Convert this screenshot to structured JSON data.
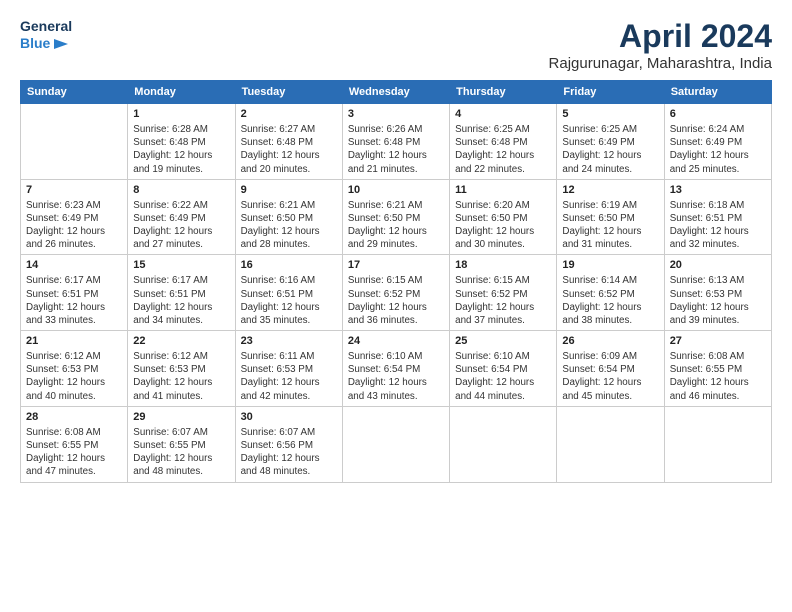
{
  "header": {
    "logo_line1": "General",
    "logo_line2": "Blue",
    "title": "April 2024",
    "subtitle": "Rajgurunagar, Maharashtra, India"
  },
  "columns": [
    "Sunday",
    "Monday",
    "Tuesday",
    "Wednesday",
    "Thursday",
    "Friday",
    "Saturday"
  ],
  "weeks": [
    [
      {
        "day": "",
        "content": ""
      },
      {
        "day": "1",
        "content": "Sunrise: 6:28 AM\nSunset: 6:48 PM\nDaylight: 12 hours\nand 19 minutes."
      },
      {
        "day": "2",
        "content": "Sunrise: 6:27 AM\nSunset: 6:48 PM\nDaylight: 12 hours\nand 20 minutes."
      },
      {
        "day": "3",
        "content": "Sunrise: 6:26 AM\nSunset: 6:48 PM\nDaylight: 12 hours\nand 21 minutes."
      },
      {
        "day": "4",
        "content": "Sunrise: 6:25 AM\nSunset: 6:48 PM\nDaylight: 12 hours\nand 22 minutes."
      },
      {
        "day": "5",
        "content": "Sunrise: 6:25 AM\nSunset: 6:49 PM\nDaylight: 12 hours\nand 24 minutes."
      },
      {
        "day": "6",
        "content": "Sunrise: 6:24 AM\nSunset: 6:49 PM\nDaylight: 12 hours\nand 25 minutes."
      }
    ],
    [
      {
        "day": "7",
        "content": "Sunrise: 6:23 AM\nSunset: 6:49 PM\nDaylight: 12 hours\nand 26 minutes."
      },
      {
        "day": "8",
        "content": "Sunrise: 6:22 AM\nSunset: 6:49 PM\nDaylight: 12 hours\nand 27 minutes."
      },
      {
        "day": "9",
        "content": "Sunrise: 6:21 AM\nSunset: 6:50 PM\nDaylight: 12 hours\nand 28 minutes."
      },
      {
        "day": "10",
        "content": "Sunrise: 6:21 AM\nSunset: 6:50 PM\nDaylight: 12 hours\nand 29 minutes."
      },
      {
        "day": "11",
        "content": "Sunrise: 6:20 AM\nSunset: 6:50 PM\nDaylight: 12 hours\nand 30 minutes."
      },
      {
        "day": "12",
        "content": "Sunrise: 6:19 AM\nSunset: 6:50 PM\nDaylight: 12 hours\nand 31 minutes."
      },
      {
        "day": "13",
        "content": "Sunrise: 6:18 AM\nSunset: 6:51 PM\nDaylight: 12 hours\nand 32 minutes."
      }
    ],
    [
      {
        "day": "14",
        "content": "Sunrise: 6:17 AM\nSunset: 6:51 PM\nDaylight: 12 hours\nand 33 minutes."
      },
      {
        "day": "15",
        "content": "Sunrise: 6:17 AM\nSunset: 6:51 PM\nDaylight: 12 hours\nand 34 minutes."
      },
      {
        "day": "16",
        "content": "Sunrise: 6:16 AM\nSunset: 6:51 PM\nDaylight: 12 hours\nand 35 minutes."
      },
      {
        "day": "17",
        "content": "Sunrise: 6:15 AM\nSunset: 6:52 PM\nDaylight: 12 hours\nand 36 minutes."
      },
      {
        "day": "18",
        "content": "Sunrise: 6:15 AM\nSunset: 6:52 PM\nDaylight: 12 hours\nand 37 minutes."
      },
      {
        "day": "19",
        "content": "Sunrise: 6:14 AM\nSunset: 6:52 PM\nDaylight: 12 hours\nand 38 minutes."
      },
      {
        "day": "20",
        "content": "Sunrise: 6:13 AM\nSunset: 6:53 PM\nDaylight: 12 hours\nand 39 minutes."
      }
    ],
    [
      {
        "day": "21",
        "content": "Sunrise: 6:12 AM\nSunset: 6:53 PM\nDaylight: 12 hours\nand 40 minutes."
      },
      {
        "day": "22",
        "content": "Sunrise: 6:12 AM\nSunset: 6:53 PM\nDaylight: 12 hours\nand 41 minutes."
      },
      {
        "day": "23",
        "content": "Sunrise: 6:11 AM\nSunset: 6:53 PM\nDaylight: 12 hours\nand 42 minutes."
      },
      {
        "day": "24",
        "content": "Sunrise: 6:10 AM\nSunset: 6:54 PM\nDaylight: 12 hours\nand 43 minutes."
      },
      {
        "day": "25",
        "content": "Sunrise: 6:10 AM\nSunset: 6:54 PM\nDaylight: 12 hours\nand 44 minutes."
      },
      {
        "day": "26",
        "content": "Sunrise: 6:09 AM\nSunset: 6:54 PM\nDaylight: 12 hours\nand 45 minutes."
      },
      {
        "day": "27",
        "content": "Sunrise: 6:08 AM\nSunset: 6:55 PM\nDaylight: 12 hours\nand 46 minutes."
      }
    ],
    [
      {
        "day": "28",
        "content": "Sunrise: 6:08 AM\nSunset: 6:55 PM\nDaylight: 12 hours\nand 47 minutes."
      },
      {
        "day": "29",
        "content": "Sunrise: 6:07 AM\nSunset: 6:55 PM\nDaylight: 12 hours\nand 48 minutes."
      },
      {
        "day": "30",
        "content": "Sunrise: 6:07 AM\nSunset: 6:56 PM\nDaylight: 12 hours\nand 48 minutes."
      },
      {
        "day": "",
        "content": ""
      },
      {
        "day": "",
        "content": ""
      },
      {
        "day": "",
        "content": ""
      },
      {
        "day": "",
        "content": ""
      }
    ]
  ]
}
